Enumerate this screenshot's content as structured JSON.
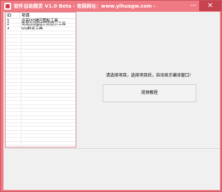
{
  "window": {
    "title": "软件自助精灵 V1.0 Beta - 官网网址：www.yihuagw.com -",
    "minimize_glyph": "—",
    "close_glyph": "✕",
    "icon": "app-icon"
  },
  "list": {
    "columns": {
      "id": "ID",
      "name": "项目"
    },
    "rows": [
      {
        "id": "1",
        "name": "点亮QQ被闪图标工具"
      },
      {
        "id": "2",
        "name": "免费QQ指纹识别提示工具"
      },
      {
        "id": "3",
        "name": "QQ群发工具"
      }
    ]
  },
  "main": {
    "prompt": "请选择项目，选择项目后，自动显示编译窗口!",
    "video_button": "视频教程"
  }
}
